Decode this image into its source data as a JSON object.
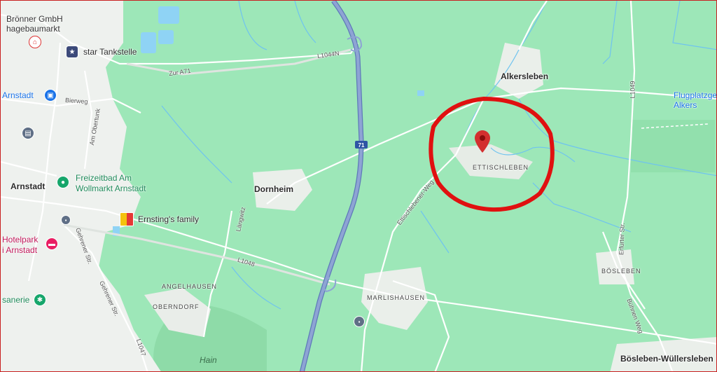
{
  "map": {
    "places": {
      "alkersleben": "Alkersleben",
      "ettischleben": "ETTISCHLEBEN",
      "dornheim": "Dornheim",
      "arnstadt": "Arnstadt",
      "angelhausen": "ANGELHAUSEN",
      "oberndorf": "OBERNDORF",
      "marlishausen": "MARLISHAUSEN",
      "bosleben": "BÖSLEBEN",
      "bosleben_wullersleben": "Bösleben-Wüllersleben",
      "hain": "Hain"
    },
    "pois": {
      "bronner_line1": "Brönner GmbH",
      "bronner_line2": "hagebaumarkt",
      "star": "star Tankstelle",
      "arnstadt_partial": "Arnstadt",
      "freizeitbad_line1": "Freizeitbad Am",
      "freizeitbad_line2": "Wollmarkt Arnstadt",
      "ernstings": "Ernsting's family",
      "hotelpark_line1": "Hotelpark",
      "hotelpark_line2": "i Arnstadt",
      "sanerie": "sanerie",
      "flugplatz_line1": "Flugplatzge",
      "flugplatz_line2": "Alkers"
    },
    "roads": {
      "l1044n": "L1044N",
      "zur_a71": "Zur A71",
      "bierweg": "Bierweg",
      "am_obertunk": "Am Obertunk",
      "langwitz": "Längwitz",
      "l1048": "L1048",
      "gehrener1": "Gehrener Str.",
      "gehrener2": "Gehrener Str.",
      "l1047": "L1047",
      "ettischlebener_weg": "Ettischlebener-Weg",
      "l1049": "L1049",
      "erfurter": "Erfurter Str.",
      "buhnen_weg": "Bühnen Weg",
      "a71": "71"
    },
    "icons": {
      "hardware": "hardware-store-icon",
      "gas": "gas-station-icon",
      "shopping": "shopping-bag-icon",
      "train": "train-station-icon",
      "swimming": "swimming-pool-icon",
      "clothing": "clothing-store-icon",
      "hotel": "hotel-icon",
      "pet": "pet-shop-icon",
      "bus": "bus-stop-icon",
      "pin": "location-pin-icon"
    },
    "colors": {
      "land": "#9de7b8",
      "urban": "#eef1ee",
      "water": "#8fd3f5",
      "motorway": "#7f96c8",
      "annotation": "#e01010",
      "pin": "#d32f2f"
    }
  }
}
